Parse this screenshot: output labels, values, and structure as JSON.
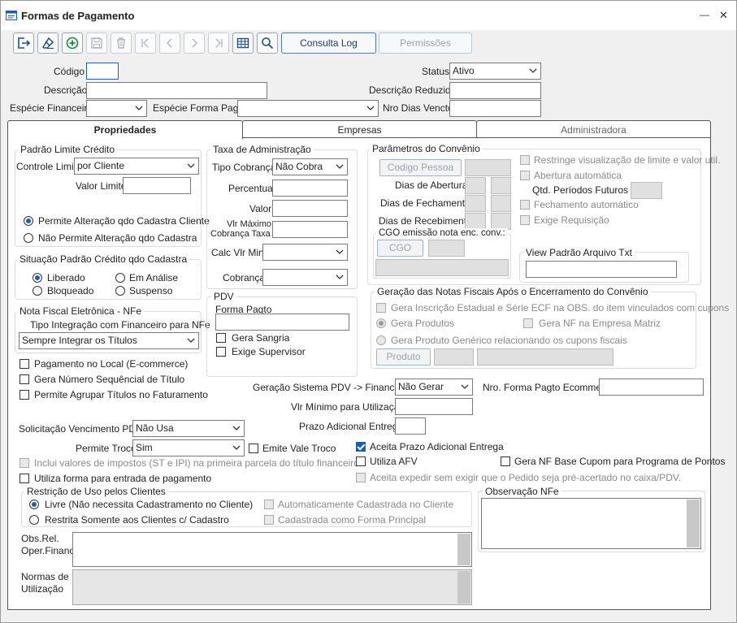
{
  "window": {
    "title": "Formas de Pagamento",
    "minimize_glyph": "—",
    "close_glyph": "✕"
  },
  "toolbar": {
    "consulta_log": "Consulta Log",
    "permissoes": "Permissões"
  },
  "header": {
    "codigo_label": "Código",
    "codigo_value": "",
    "status_label": "Status",
    "status_value": "Ativo",
    "descricao_label": "Descrição",
    "descricao_value": "",
    "descricao_reduzida_label": "Descrição Reduzida",
    "descricao_reduzida_value": "",
    "especie_financeira_label": "Espécie Financeira",
    "especie_financeira_value": "",
    "especie_forma_pagto_label": "Espécie Forma Pagto",
    "especie_forma_pagto_value": "",
    "nro_dias_vencto_label": "Nro Dias Vencto",
    "nro_dias_vencto_value": ""
  },
  "tabs": {
    "propriedades": "Propriedades",
    "empresas": "Empresas",
    "administradora": "Administradora"
  },
  "padrao_limite": {
    "title": "Padrão Limite Crédito",
    "controle_limite_label": "Controle Limite",
    "controle_limite_value": "por Cliente",
    "valor_limite_label": "Valor Limite",
    "permite": "Permite Alteração qdo Cadastra Cliente",
    "nao_permite": "Não Permite Alteração qdo Cadastra"
  },
  "situacao": {
    "title": "Situação Padrão Crédito qdo Cadastra",
    "liberado": "Liberado",
    "em_analise": "Em Análise",
    "bloqueado": "Bloqueado",
    "suspenso": "Suspenso"
  },
  "nfe": {
    "title": "Nota Fiscal Eletrônica - NFe",
    "tipo_label": "Tipo Integração com Financeiro para NFe",
    "tipo_value": "Sempre Integrar os Títulos"
  },
  "checks_left": {
    "pagamento_local": "Pagamento no Local (E-commerce)",
    "gera_numero": "Gera Número Sequêncial de Título",
    "permite_agrupar": "Permite Agrupar Títulos no Faturamento"
  },
  "taxa": {
    "title": "Taxa de Administração",
    "tipo_cobranca_label": "Tipo Cobrança",
    "tipo_cobranca_value": "Não Cobra",
    "percentual_label": "Percentual",
    "valor_label": "Valor",
    "vlr_maximo_label_1": "Vlr Máximo",
    "vlr_maximo_label_2": "Cobrança Taxa",
    "calc_vlr_min_label": "Calc Vlr Min",
    "cobranca_label": "Cobrança"
  },
  "pdv": {
    "title": "PDV",
    "forma_pagto_label": "Forma Pagto",
    "gera_sangria": "Gera Sangria",
    "exige_supervisor": "Exige Supervisor"
  },
  "convenio": {
    "title": "Parâmetros do Convênio",
    "codigo_pessoa": "Codigo Pessoa",
    "dias_abertura": "Dias de Abertura",
    "dias_fechamento": "Dias de Fechamento",
    "dias_recebimento": "Dias de Recebimento",
    "restringe": "Restringe visualização de limite e valor util.",
    "abertura_auto": "Abertura automática",
    "qtd_periodos": "Qtd. Períodos Futuros",
    "fechamento_auto": "Fechamento automático",
    "exige_requisicao": "Exige Requisição",
    "cgo_title": "CGO emissão nota enc. conv.:",
    "cgo_button": "CGO",
    "view_padrao": "View Padrão Arquivo Txt"
  },
  "geracao": {
    "title": "Geração das Notas Fiscais Após o Encerramento do Convênio",
    "gera_inscricao": "Gera Inscrição Estadual e Série ECF na OBS. do item vinculados com cupons",
    "gera_produtos": "Gera Produtos",
    "gera_nf_matriz": "Gera NF na Empresa Matriz",
    "gera_produto_generico": "Gera Produto Genérico relacionando os cupons fiscais",
    "produto_button": "Produto"
  },
  "mid": {
    "geracao_pdv_label": "Geração Sistema PDV -> Financeiro",
    "geracao_pdv_value": "Não Gerar",
    "nro_forma_ecommerce_label": "Nro. Forma Pagto Ecommerce",
    "vlr_minimo_label": "Vlr Mínimo para Utilização",
    "prazo_adicional_label": "Prazo Adicional Entrega",
    "solicitacao_label": "Solicitação Vencimento PDV",
    "solicitacao_value": "Não Usa",
    "permite_troco_label": "Permite Troco",
    "permite_troco_value": "Sim",
    "emite_vale_troco": "Emite Vale Troco",
    "aceita_prazo": "Aceita Prazo Adicional Entrega",
    "inclui_valores": "Inclui valores de impostos (ST e IPI) na primeira parcela do título financeiro",
    "utiliza_afv": "Utiliza AFV",
    "gera_nf_base": "Gera NF Base Cupom para Programa de Pontos",
    "utiliza_forma": "Utiliza forma para entrada de pagamento",
    "aceita_expedir": "Aceita expedir sem exigir que o Pedido seja pré-acertado no caixa/PDV."
  },
  "restricao": {
    "title": "Restrição de Uso pelos Clientes",
    "livre": "Livre (Não necessita Cadastramento no Cliente)",
    "restrita": "Restrita Somente aos Clientes c/ Cadastro",
    "auto_cadastrada": "Automaticamente Cadastrada no Cliente",
    "cadastrada_principal": "Cadastrada como Forma Principal"
  },
  "obs_nfe": {
    "title": "Observação NFe"
  },
  "bottom": {
    "obs_rel_1": "Obs.Rel.",
    "obs_rel_2": "Oper.Financ.",
    "normas_1": "Normas de",
    "normas_2": "Utilização"
  }
}
